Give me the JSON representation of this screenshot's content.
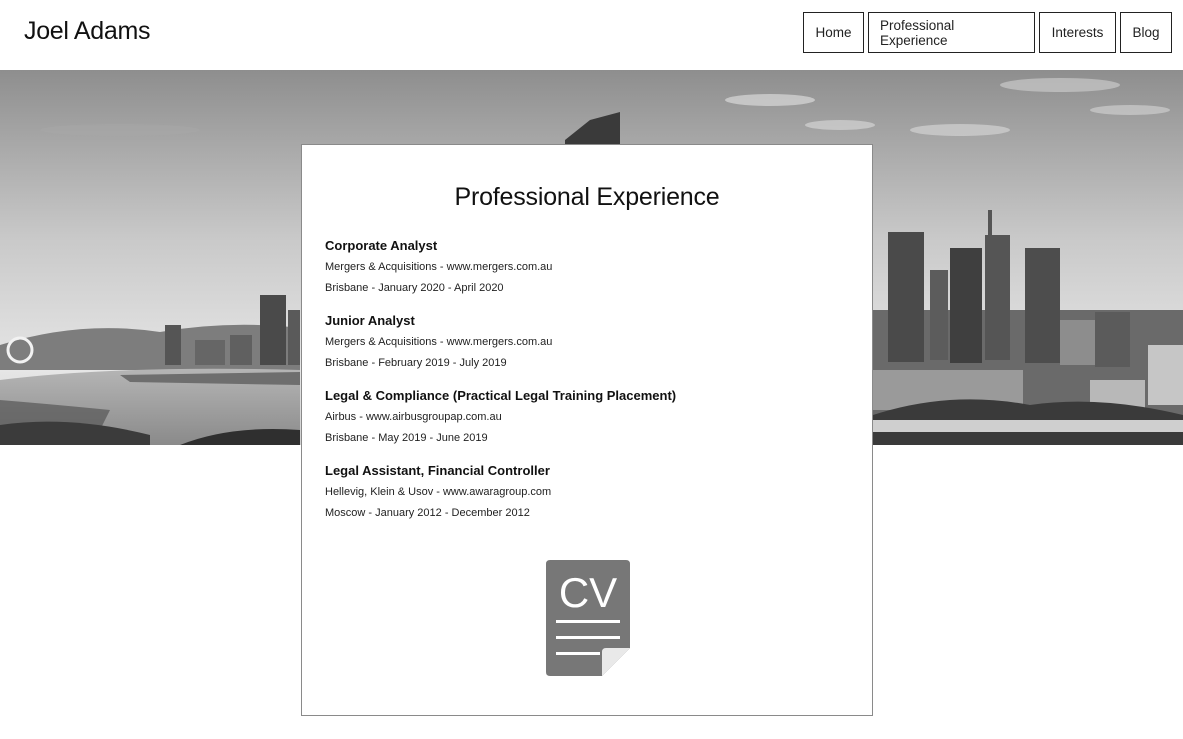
{
  "header": {
    "site_title": "Joel Adams",
    "nav": [
      {
        "label": "Home"
      },
      {
        "label": "Professional Experience"
      },
      {
        "label": "Interests"
      },
      {
        "label": "Blog"
      }
    ]
  },
  "card": {
    "title": "Professional Experience",
    "entries": [
      {
        "role": "Corporate Analyst",
        "company": "Mergers & Acquisitions - www.mergers.com.au",
        "dates": "Brisbane - January 2020 - April 2020"
      },
      {
        "role": "Junior Analyst",
        "company": "Mergers & Acquisitions - www.mergers.com.au",
        "dates": "Brisbane - February 2019 - July 2019"
      },
      {
        "role": "Legal & Compliance (Practical Legal Training Placement)",
        "company": "Airbus - www.airbusgroupap.com.au",
        "dates": "Brisbane - May 2019 - June 2019"
      },
      {
        "role": "Legal Assistant, Financial Controller",
        "company": "Hellevig, Klein & Usov - www.awaragroup.com",
        "dates": "Moscow - January 2012 - December 2012"
      }
    ],
    "cv_icon": {
      "name": "cv-document-icon",
      "text": "CV",
      "color": "#777777"
    }
  }
}
